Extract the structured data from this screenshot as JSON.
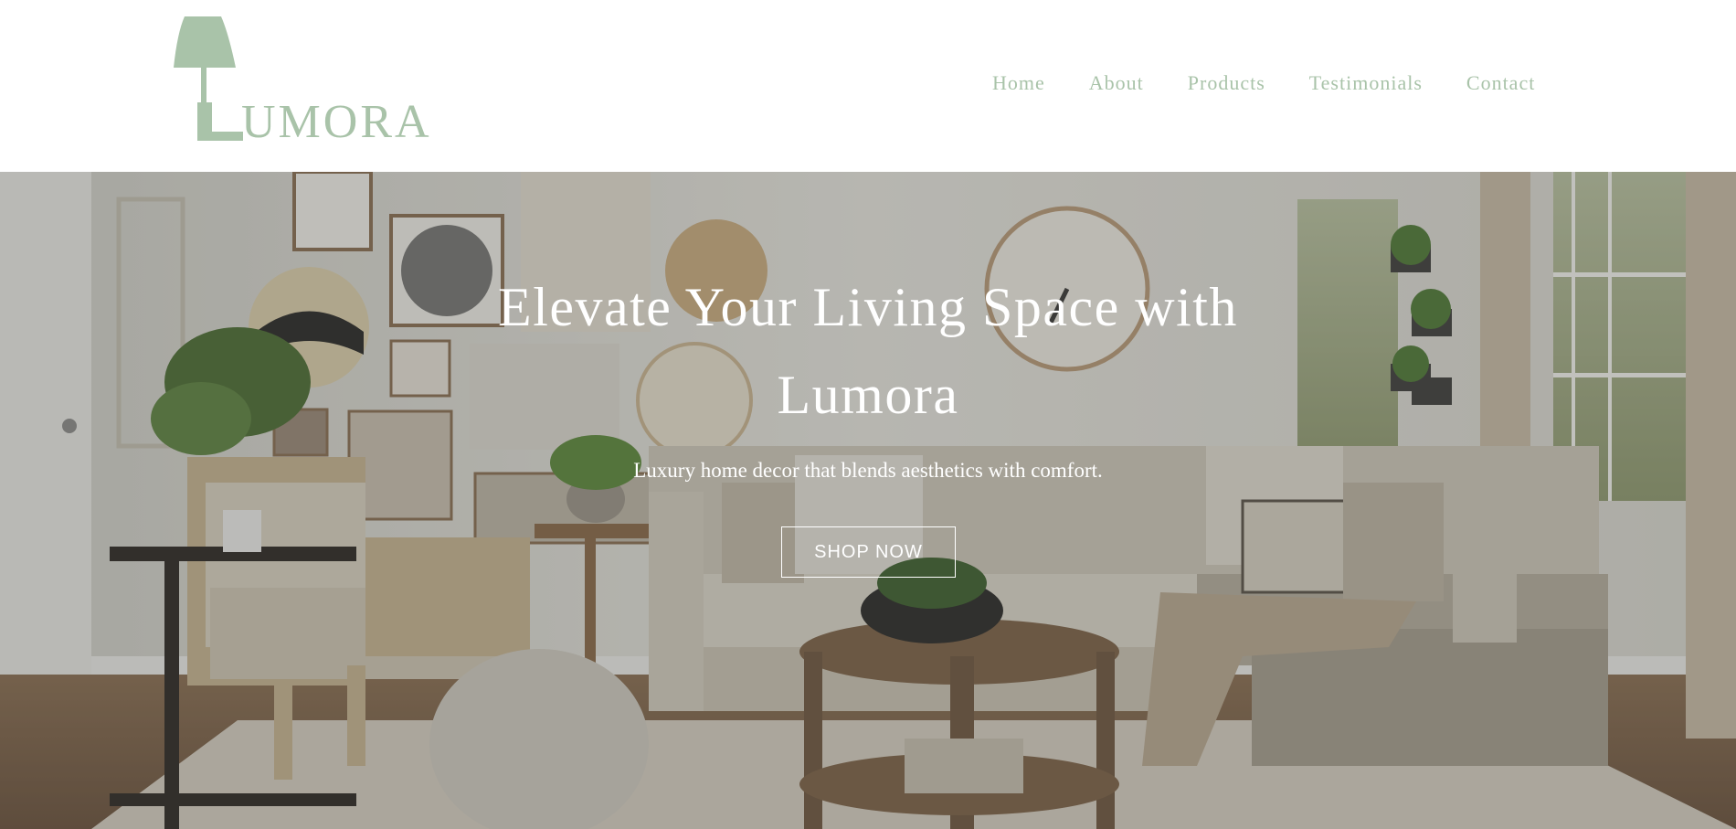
{
  "brand": {
    "logo_text": "UMORA",
    "logo_full_name": "LUMORA",
    "color": "#a9c3a9"
  },
  "nav": {
    "items": [
      {
        "label": "Home"
      },
      {
        "label": "About"
      },
      {
        "label": "Products"
      },
      {
        "label": "Testimonials"
      },
      {
        "label": "Contact"
      }
    ]
  },
  "hero": {
    "title": "Elevate Your Living Space with Lumora",
    "subtitle": "Luxury home decor that blends aesthetics with comfort.",
    "cta_label": "SHOP NOW",
    "background_image": "living-room-photo"
  },
  "colors": {
    "accent": "#a9c3a9",
    "text_on_hero": "#ffffff"
  }
}
